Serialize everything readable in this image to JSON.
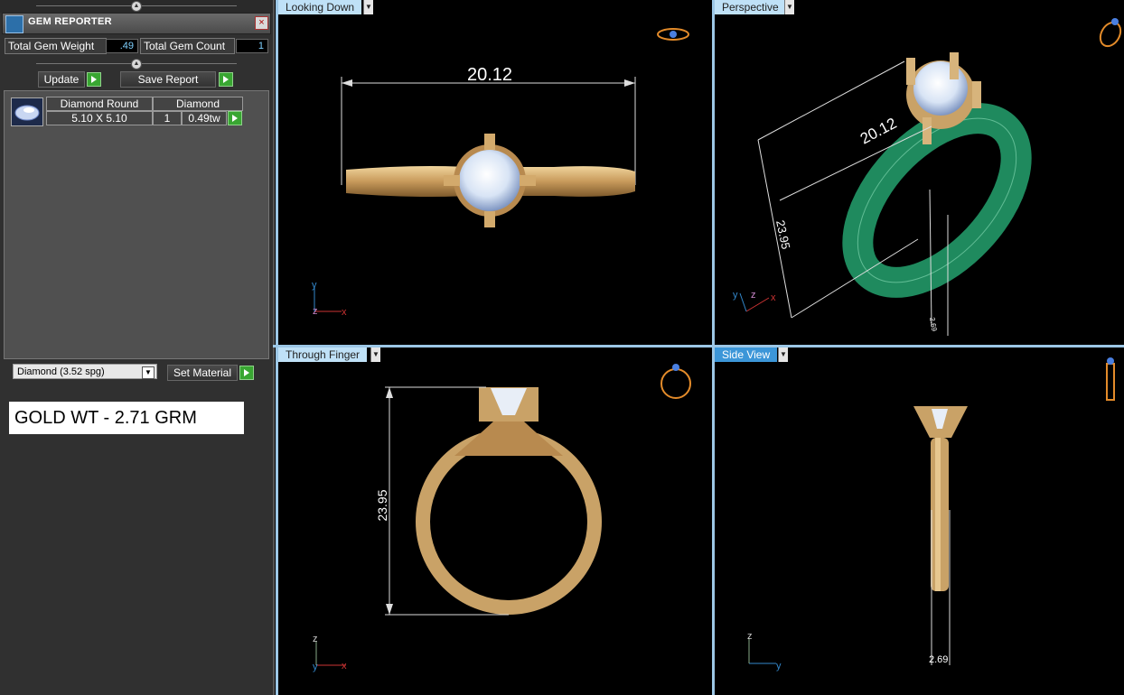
{
  "panel": {
    "title": "GEM REPORTER",
    "close_label": "×",
    "total_gem_weight_label": "Total Gem Weight",
    "total_gem_weight_value": ".49",
    "total_gem_count_label": "Total Gem Count",
    "total_gem_count_value": "1",
    "update_label": "Update",
    "save_report_label": "Save Report",
    "gem_row": {
      "shape": "Diamond Round",
      "material": "Diamond",
      "size": "5.10 X 5.10",
      "count": "1",
      "weight": "0.49tw"
    },
    "material_select": "Diamond    (3.52 spg)",
    "set_material_label": "Set Material",
    "gold_weight": "GOLD WT - 2.71 GRM"
  },
  "viewports": [
    {
      "name": "Looking Down",
      "active": false,
      "dimension": "20.12",
      "axes": [
        "y",
        "z",
        "x"
      ]
    },
    {
      "name": "Perspective",
      "active": false,
      "dimensions": [
        "20.12",
        "23.95",
        "2.69"
      ],
      "axes": [
        "y",
        "z",
        "x"
      ]
    },
    {
      "name": "Through Finger",
      "active": false,
      "dimension": "23.95",
      "axes": [
        "z",
        "y",
        "x"
      ]
    },
    {
      "name": "Side View",
      "active": true,
      "dimension": "2.69",
      "axes": [
        "z",
        "y"
      ]
    }
  ],
  "colors": {
    "gold": "#c9a267",
    "ring_green": "#1f8a5e",
    "tab_inactive": "#bfe1f7",
    "tab_active": "#3c96d8",
    "play_green": "#39a632"
  }
}
